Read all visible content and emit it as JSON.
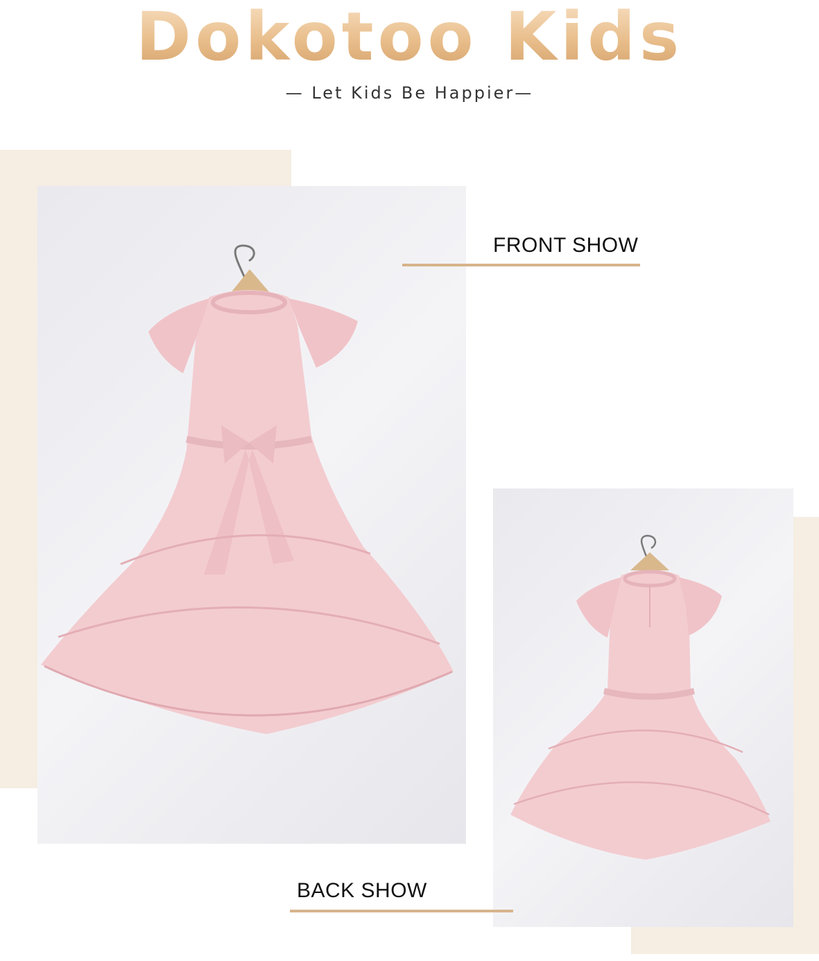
{
  "header": {
    "brand": "Dokotoo Kids",
    "tagline": "— Let Kids Be Happier—"
  },
  "sections": {
    "front_label": "FRONT SHOW",
    "back_label": "BACK SHOW"
  },
  "colors": {
    "brand_gold": "#dcae7c",
    "beige_panel": "#f6ede3",
    "accent_rule": "#d8b48c",
    "dress_pink": "#f3ccd0"
  },
  "images": {
    "front": "pink-dress-front-photo",
    "back": "pink-dress-back-photo"
  }
}
